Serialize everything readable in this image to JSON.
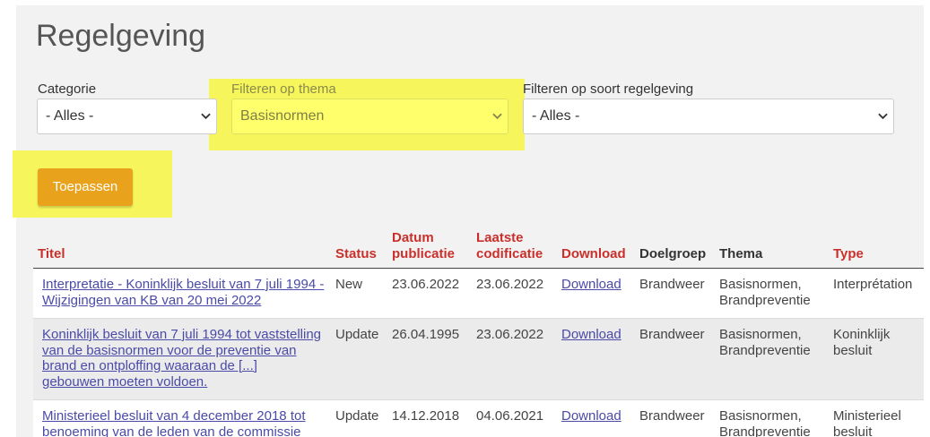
{
  "page": {
    "title": "Regelgeving"
  },
  "colors": {
    "header_link": "#c9302c",
    "link": "#4a4aa8",
    "apply_button": "#e9a21b",
    "highlight": "#f6f65c"
  },
  "filters": {
    "category": {
      "label": "Categorie",
      "value": "- Alles -"
    },
    "theme": {
      "label": "Filteren op thema",
      "value": "Basisnormen"
    },
    "regulation_type": {
      "label": "Filteren op soort regelgeving",
      "value": "- Alles -"
    },
    "apply_button": "Toepassen"
  },
  "table": {
    "headers": [
      "Titel",
      "Status",
      "Datum publicatie",
      "Laatste codificatie",
      "Download",
      "Doelgroep",
      "Thema",
      "Type"
    ],
    "rows": [
      {
        "title_lines": [
          "Interpretatie - Koninklijk besluit van 7 juli 1994 -",
          "Wijzigingen van KB van 20 mei 2022"
        ],
        "status": "New",
        "published": "23.06.2022",
        "codified": "23.06.2022",
        "download": "Download",
        "audience": "Brandweer",
        "theme": "Basisnormen, Brandpreventie",
        "type": "Interprétation"
      },
      {
        "title_lines": [
          "Koninklijk besluit van 7 juli 1994 tot vaststelling",
          "van de basisnormen voor de preventie van",
          "brand en ontploffing waaraan de [...]",
          "gebouwen moeten voldoen."
        ],
        "status": "Update",
        "published": "26.04.1995",
        "codified": "23.06.2022",
        "download": "Download",
        "audience": "Brandweer",
        "theme": "Basisnormen, Brandpreventie",
        "type": "Koninklijk besluit"
      },
      {
        "title_lines": [
          "Ministerieel besluit van 4 december 2018 tot",
          "benoeming van de leden van de commissie"
        ],
        "status": "Update",
        "published": "14.12.2018",
        "codified": "04.06.2021",
        "download": "Download",
        "audience": "Brandweer",
        "theme": "Basisnormen, Brandpreventie",
        "type": "Ministerieel besluit"
      }
    ]
  }
}
